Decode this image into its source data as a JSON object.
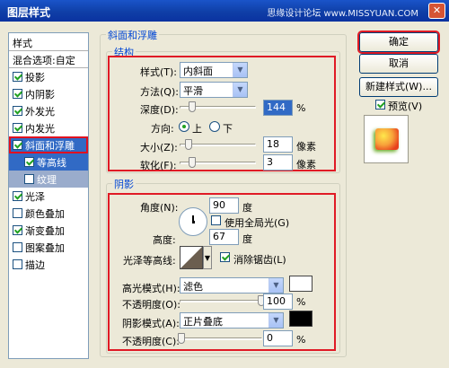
{
  "window": {
    "title": "图层样式",
    "watermark": "思缘设计论坛 www.MISSYUAN.COM",
    "close_glyph": "✕"
  },
  "sidebar": {
    "header": "样式",
    "blend_options": "混合选项:自定",
    "items": [
      {
        "label": "投影",
        "checked": true
      },
      {
        "label": "内阴影",
        "checked": true
      },
      {
        "label": "外发光",
        "checked": true
      },
      {
        "label": "内发光",
        "checked": true
      },
      {
        "label": "斜面和浮雕",
        "checked": true
      },
      {
        "label": "等高线",
        "checked": true
      },
      {
        "label": "纹理",
        "checked": false
      },
      {
        "label": "光泽",
        "checked": true
      },
      {
        "label": "颜色叠加",
        "checked": false
      },
      {
        "label": "渐变叠加",
        "checked": true
      },
      {
        "label": "图案叠加",
        "checked": false
      },
      {
        "label": "描边",
        "checked": false
      }
    ]
  },
  "bevel": {
    "group_title": "斜面和浮雕",
    "structure_title": "结构",
    "style_label": "样式(T):",
    "style_value": "内斜面",
    "method_label": "方法(Q):",
    "method_value": "平滑",
    "depth_label": "深度(D):",
    "depth_value": "144",
    "depth_unit": "%",
    "direction_label": "方向:",
    "direction_up": "上",
    "direction_down": "下",
    "size_label": "大小(Z):",
    "size_value": "18",
    "size_unit": "像素",
    "soften_label": "软化(F):",
    "soften_value": "3",
    "soften_unit": "像素"
  },
  "shading": {
    "title": "阴影",
    "angle_label": "角度(N):",
    "angle_value": "90",
    "angle_unit": "度",
    "global_light_label": "使用全局光(G)",
    "altitude_label": "高度:",
    "altitude_value": "67",
    "altitude_unit": "度",
    "gloss_label": "光泽等高线:",
    "antialias_label": "消除锯齿(L)",
    "highlight_mode_label": "高光模式(H):",
    "highlight_mode_value": "滤色",
    "highlight_color": "#ffffff",
    "highlight_opacity_label": "不透明度(O):",
    "highlight_opacity_value": "100",
    "shadow_mode_label": "阴影模式(A):",
    "shadow_mode_value": "正片叠底",
    "shadow_color": "#000000",
    "shadow_opacity_label": "不透明度(C):",
    "shadow_opacity_value": "0",
    "percent": "%"
  },
  "buttons": {
    "ok": "确定",
    "cancel": "取消",
    "new_style": "新建样式(W)...",
    "preview_label": "预览(V)"
  }
}
